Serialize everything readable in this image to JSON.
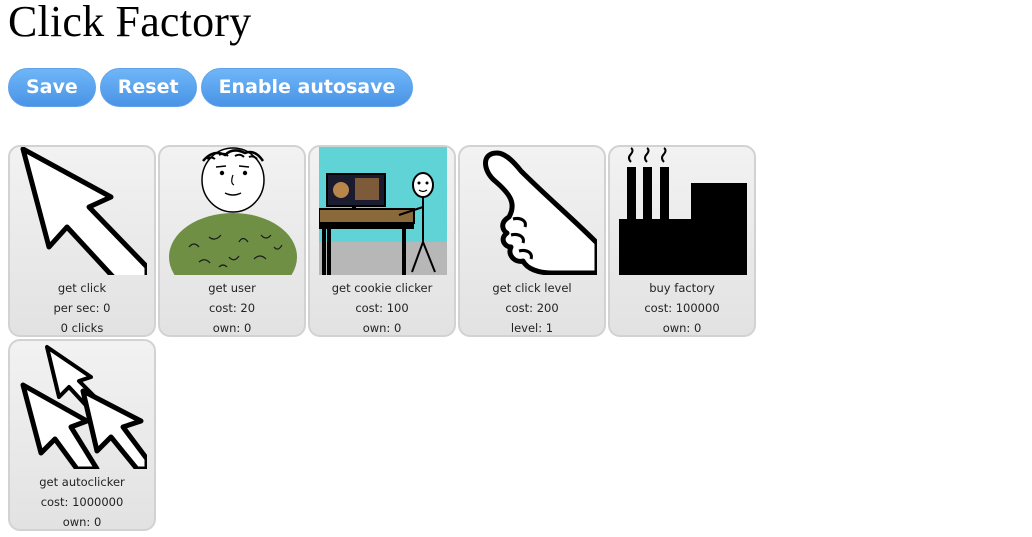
{
  "title": "Click Factory",
  "buttons": {
    "save": "Save",
    "reset": "Reset",
    "autosave": "Enable autosave"
  },
  "cards": [
    {
      "name": "get click",
      "line2": "per sec: 0",
      "line3": "0 clicks",
      "icon": "cursor-arrow-icon"
    },
    {
      "name": "get user",
      "line2": "cost: 20",
      "line3": "own: 0",
      "icon": "user-icon"
    },
    {
      "name": "get cookie clicker",
      "line2": "cost: 100",
      "line3": "own: 0",
      "icon": "cookie-clicker-icon"
    },
    {
      "name": "get click level",
      "line2": "cost: 200",
      "line3": "level: 1",
      "icon": "pointing-hand-icon"
    },
    {
      "name": "buy factory",
      "line2": "cost: 100000",
      "line3": "own: 0",
      "icon": "factory-icon"
    },
    {
      "name": "get autoclicker",
      "line2": "cost: 1000000",
      "line3": "own: 0",
      "icon": "autoclicker-icon"
    }
  ]
}
